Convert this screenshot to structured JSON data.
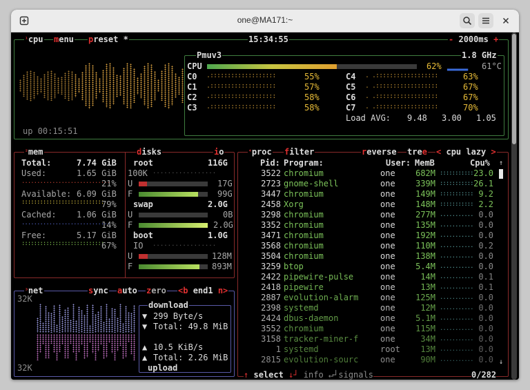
{
  "window": {
    "title": "one@MA171:~"
  },
  "cpu": {
    "hdr_cpu": "cpu",
    "hdr_menu": "menu",
    "hdr_preset": "preset *",
    "clock": "15:34:55",
    "interval": "2000ms",
    "model": "Pmuv3",
    "freq": "1.8 GHz",
    "total_label": "CPU",
    "total_pct": "62%",
    "total_pct_value": 62,
    "temp": "61°C",
    "cores": [
      {
        "name": "C0",
        "pct": "55%"
      },
      {
        "name": "C1",
        "pct": "57%"
      },
      {
        "name": "C2",
        "pct": "58%"
      },
      {
        "name": "C3",
        "pct": "58%"
      },
      {
        "name": "C4",
        "pct": "63%"
      },
      {
        "name": "C5",
        "pct": "67%"
      },
      {
        "name": "C6",
        "pct": "67%"
      },
      {
        "name": "C7",
        "pct": "70%"
      }
    ],
    "load_label": "Load AVG:",
    "load1": "9.48",
    "load5": "3.00",
    "load15": "1.05",
    "uptime": "up 00:15:51"
  },
  "mem": {
    "title": "mem",
    "total_label": "Total:",
    "total": "7.74 GiB",
    "used_label": "Used:",
    "used": "1.65 GiB",
    "used_pct": "21%",
    "avail_label": "Available:",
    "avail": "6.09 GiB",
    "avail_pct": "79%",
    "cached_label": "Cached:",
    "cached": "1.06 GiB",
    "cached_pct": "14%",
    "free_label": "Free:",
    "free": "5.17 GiB",
    "free_pct": "67%"
  },
  "disks": {
    "title": "disks",
    "io": "io",
    "root": {
      "name": "root",
      "size": "116G",
      "io": "100K",
      "u_label": "U",
      "u": "17G",
      "u_frac": 0.12,
      "f_label": "F",
      "f": "99G",
      "f_frac": 0.86
    },
    "swap": {
      "name": "swap",
      "size": "2.0G",
      "u_label": "U",
      "u": "0B",
      "u_frac": 0.0,
      "f_label": "F",
      "f": "2.0G",
      "f_frac": 1.0
    },
    "boot": {
      "name": "boot",
      "size": "1.0G",
      "io": "IO",
      "u_label": "U",
      "u": "128M",
      "u_frac": 0.13,
      "f_label": "F",
      "f": "893M",
      "f_frac": 0.88
    }
  },
  "net": {
    "title": "net",
    "sync": "sync",
    "auto": "auto",
    "zero": "zero",
    "iface_prev": "<b",
    "iface": "end1",
    "iface_next": "n>",
    "scale_top": "32K",
    "scale_bottom": "32K",
    "download_label": "download",
    "dl_rate": "299 Byte/s",
    "dl_total": "Total: 49.8 MiB",
    "up_rate": "10.5 KiB/s",
    "up_total": "Total: 2.26 MiB",
    "upload_label": "upload"
  },
  "proc": {
    "title": "proc",
    "filter": "filter",
    "reverse": "reverse",
    "tree": "tree",
    "mode": "< cpu lazy >",
    "col_pid": "Pid:",
    "col_program": "Program:",
    "col_user": "User:",
    "col_memb": "MemB",
    "col_cpu": "Cpu%",
    "rows": [
      {
        "pid": "3522",
        "program": "chromium",
        "user": "one",
        "mem": "682M",
        "cpu": "23.0"
      },
      {
        "pid": "2723",
        "program": "gnome-shell",
        "user": "one",
        "mem": "339M",
        "cpu": "26.1"
      },
      {
        "pid": "3447",
        "program": "chromium",
        "user": "one",
        "mem": "149M",
        "cpu": "9.2"
      },
      {
        "pid": "2458",
        "program": "Xorg",
        "user": "one",
        "mem": "148M",
        "cpu": "2.2"
      },
      {
        "pid": "3298",
        "program": "chromium",
        "user": "one",
        "mem": "277M",
        "cpu": "0.0"
      },
      {
        "pid": "3352",
        "program": "chromium",
        "user": "one",
        "mem": "135M",
        "cpu": "0.0"
      },
      {
        "pid": "3471",
        "program": "chromium",
        "user": "one",
        "mem": "192M",
        "cpu": "0.0"
      },
      {
        "pid": "3568",
        "program": "chromium",
        "user": "one",
        "mem": "110M",
        "cpu": "0.2"
      },
      {
        "pid": "3504",
        "program": "chromium",
        "user": "one",
        "mem": "138M",
        "cpu": "0.0"
      },
      {
        "pid": "3259",
        "program": "btop",
        "user": "one",
        "mem": "5.4M",
        "cpu": "0.0"
      },
      {
        "pid": "2422",
        "program": "pipewire-pulse",
        "user": "one",
        "mem": "14M",
        "cpu": "0.1"
      },
      {
        "pid": "2418",
        "program": "pipewire",
        "user": "one",
        "mem": "13M",
        "cpu": "0.1"
      },
      {
        "pid": "2887",
        "program": "evolution-alarm",
        "user": "one",
        "mem": "125M",
        "cpu": "0.0"
      },
      {
        "pid": "2398",
        "program": "systemd",
        "user": "one",
        "mem": "12M",
        "cpu": "0.0"
      },
      {
        "pid": "2424",
        "program": "dbus-daemon",
        "user": "one",
        "mem": "5.1M",
        "cpu": "0.0"
      },
      {
        "pid": "3552",
        "program": "chromium",
        "user": "one",
        "mem": "115M",
        "cpu": "0.0"
      },
      {
        "pid": "3158",
        "program": "tracker-miner-f",
        "user": "one",
        "mem": "34M",
        "cpu": "0.0"
      },
      {
        "pid": "1",
        "program": "systemd",
        "user": "root",
        "mem": "13M",
        "cpu": "0.0"
      },
      {
        "pid": "2815",
        "program": "evolution-sourc",
        "user": "one",
        "mem": "90M",
        "cpu": "0.0"
      }
    ],
    "footer_select": "select",
    "footer_info": "info",
    "footer_signals": "signals",
    "count": "0/282"
  },
  "colors": {
    "border_green": "#3f7d3f",
    "border_red": "#8a2a2a",
    "border_blue": "#5a5aa8",
    "hotkey": "#e03030",
    "pct": "#e8bc38",
    "proc_green": "#7cc35a"
  }
}
